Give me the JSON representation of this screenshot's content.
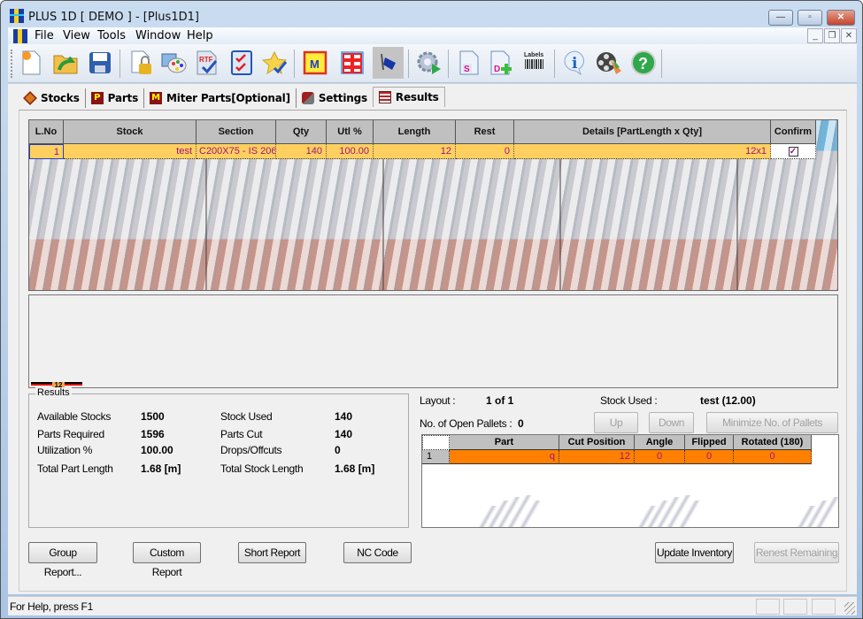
{
  "window": {
    "title": "PLUS 1D [ DEMO ] - [Plus1D1]",
    "controls": {
      "minimize": "—",
      "maximize": "▫",
      "close": "✕"
    },
    "mdi_controls": {
      "minimize": "_",
      "restore": "❐",
      "close": "✕"
    }
  },
  "menu": [
    "File",
    "View",
    "Tools",
    "Window",
    "Help"
  ],
  "toolbar": [
    {
      "name": "new-icon"
    },
    {
      "name": "open-icon"
    },
    {
      "name": "save-icon"
    },
    {
      "name": "lock-document-icon"
    },
    {
      "name": "palette-icon"
    },
    {
      "name": "rtf-export-icon"
    },
    {
      "name": "checklist-icon"
    },
    {
      "name": "favorite-star-icon"
    },
    {
      "name": "miter-icon",
      "text": "M"
    },
    {
      "name": "grid-layout-icon"
    },
    {
      "name": "tag-icon"
    },
    {
      "name": "run-optimize-icon"
    },
    {
      "name": "stock-doc-icon",
      "text": "S"
    },
    {
      "name": "add-doc-icon",
      "text": "D"
    },
    {
      "name": "labels-icon",
      "text": "Labels"
    },
    {
      "name": "info-icon",
      "text": "i"
    },
    {
      "name": "video-icon"
    },
    {
      "name": "help-icon",
      "text": "?"
    }
  ],
  "tabs": [
    {
      "label": "Stocks"
    },
    {
      "label": "Parts"
    },
    {
      "label": "Miter Parts[Optional]"
    },
    {
      "label": "Settings"
    },
    {
      "label": "Results",
      "active": true
    }
  ],
  "results_grid": {
    "columns": [
      "L.No",
      "Stock",
      "Section",
      "Qty",
      "Utl %",
      "Length",
      "Rest",
      "Details [PartLength x Qty]",
      "Confirm"
    ],
    "rows": [
      {
        "lno": "1",
        "stock": "test",
        "section": "C200X75 - IS 206",
        "qty": "140",
        "utl": "100.00",
        "length": "12",
        "rest": "0",
        "details": "12x1",
        "confirm": true
      }
    ]
  },
  "layout_drawing": {
    "cut_label": "12"
  },
  "results_summary": {
    "legend": "Results",
    "left": [
      {
        "label": "Available Stocks",
        "value": "1500"
      },
      {
        "label": "Parts Required",
        "value": "1596"
      },
      {
        "label": "Utilization %",
        "value": "100.00"
      },
      {
        "label": "Total Part Length",
        "value": "1.68 [m]"
      }
    ],
    "right": [
      {
        "label": "Stock Used",
        "value": "140"
      },
      {
        "label": "Parts Cut",
        "value": "140"
      },
      {
        "label": "Drops/Offcuts",
        "value": "0"
      },
      {
        "label": "Total Stock Length",
        "value": "1.68 [m]"
      }
    ]
  },
  "layout_info": {
    "layout_label": "Layout  :",
    "layout_value": "1 of 1",
    "stock_used_label": "Stock Used  :",
    "stock_used_value": "test (12.00)",
    "open_pallets_label": "No. of Open Pallets :",
    "open_pallets_value": "0",
    "up_button": "Up",
    "down_button": "Down",
    "minimize_pallets_button": "Minimize No. of Pallets"
  },
  "parts_grid": {
    "columns": [
      "",
      "Part",
      "Cut Position",
      "Angle",
      "Flipped",
      "Rotated (180)"
    ],
    "rows": [
      {
        "index": "1",
        "part": "q",
        "cut_position": "12",
        "angle": "0",
        "flipped": "0",
        "rotated": "0"
      }
    ]
  },
  "buttons": {
    "group_report": "Group Report...",
    "custom_report": "Custom Report",
    "short_report": "Short Report",
    "nc_code": "NC Code",
    "update_inventory": "Update Inventory",
    "renest_remaining": "Renest Remaining"
  },
  "statusbar": {
    "text": "For Help, press F1"
  },
  "colors": {
    "row_highlight": "#ffd060",
    "part_row": "#ff8000",
    "cell_text": "#a0127a"
  }
}
